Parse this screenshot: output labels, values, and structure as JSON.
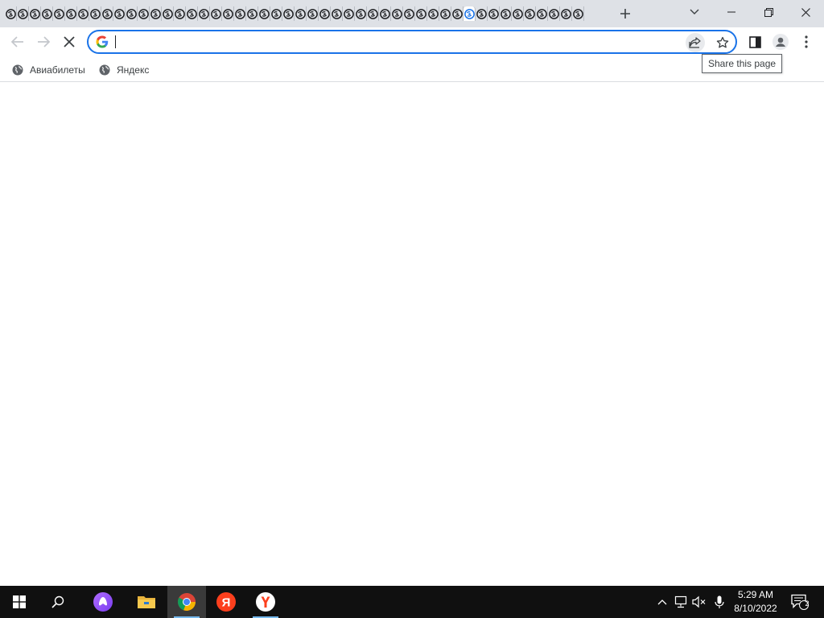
{
  "browser": {
    "tab_count": 48,
    "active_tab_index": 38,
    "omnibox": {
      "value": "",
      "placeholder": ""
    },
    "tooltip": "Share this page",
    "bookmarks": [
      {
        "label": "Авиабилеты",
        "icon": "globe-icon"
      },
      {
        "label": "Яндекс",
        "icon": "globe-icon"
      }
    ],
    "colors": {
      "accent": "#1a73e8",
      "tabstrip": "#dee1e6"
    }
  },
  "taskbar": {
    "apps": [
      {
        "name": "start-button",
        "icon": "windows-logo-icon"
      },
      {
        "name": "search-button",
        "icon": "search-icon"
      },
      {
        "name": "alice-button",
        "icon": "alice-icon"
      },
      {
        "name": "file-explorer-button",
        "icon": "folder-icon"
      },
      {
        "name": "chrome-button",
        "icon": "chrome-icon"
      },
      {
        "name": "yandex-button",
        "icon": "yandex-icon"
      },
      {
        "name": "yandex-browser-button",
        "icon": "yandex-browser-icon"
      }
    ],
    "clock": {
      "time": "5:29 AM",
      "date": "8/10/2022"
    },
    "notification_count": "2"
  }
}
